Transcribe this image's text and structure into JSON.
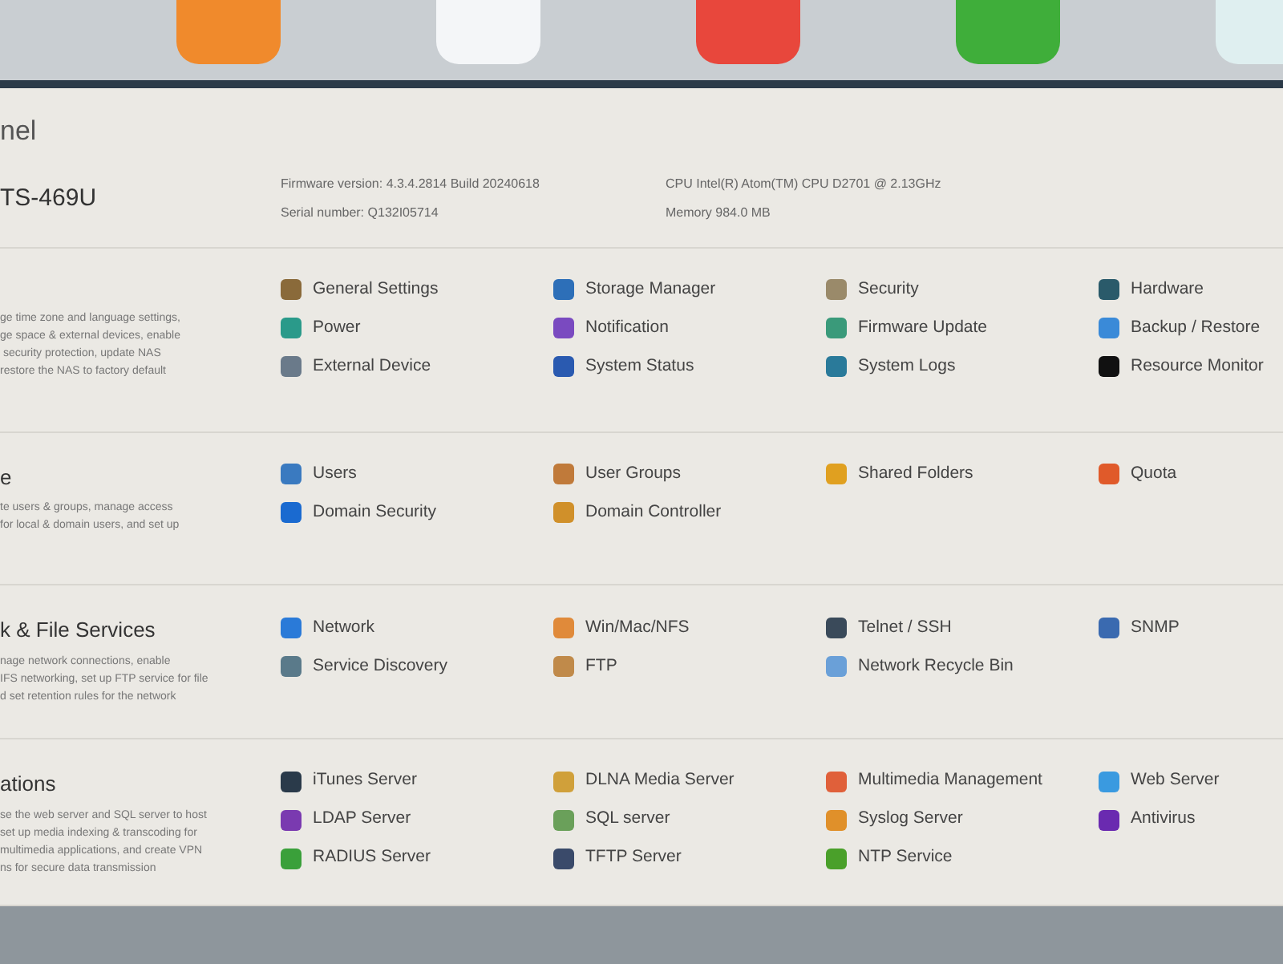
{
  "dock": {
    "apps": [
      {
        "color": "#f08a2c"
      },
      {
        "color": "#f4f6f8"
      },
      {
        "color": "#e8473c"
      },
      {
        "color": "#3fae3a"
      },
      {
        "color": "#dfeff0"
      }
    ]
  },
  "window": {
    "title": "nel"
  },
  "device": {
    "model": "TS-469U",
    "info": [
      {
        "label": "Firmware version:",
        "value": "4.3.4.2814 Build 20240618"
      },
      {
        "label": "CPU",
        "value": "Intel(R) Atom(TM) CPU D2701 @ 2.13GHz"
      },
      {
        "label": "Serial number:",
        "value": "Q132I05714"
      },
      {
        "label": "Memory",
        "value": "984.0 MB"
      }
    ]
  },
  "sections": [
    {
      "description": [
        "ge time zone and language settings,",
        "ge space & external devices, enable",
        " security protection, update NAS",
        "restore the NAS to factory default"
      ],
      "items": [
        {
          "label": "General Settings",
          "color": "#8a6a3a"
        },
        {
          "label": "Storage Manager",
          "color": "#2d6fb8"
        },
        {
          "label": "Security",
          "color": "#9a8a6a"
        },
        {
          "label": "Hardware",
          "color": "#2a5a6a"
        },
        {
          "label": "Power",
          "color": "#2a9a8a"
        },
        {
          "label": "Notification",
          "color": "#7a4ac0"
        },
        {
          "label": "Firmware Update",
          "color": "#3a9a7a"
        },
        {
          "label": "Backup / Restore",
          "color": "#3a8ad8"
        },
        {
          "label": "External Device",
          "color": "#6a7a8a"
        },
        {
          "label": "System Status",
          "color": "#2a5ab0"
        },
        {
          "label": "System Logs",
          "color": "#2a7a9a"
        },
        {
          "label": "Resource Monitor",
          "color": "#111111"
        }
      ]
    },
    {
      "title": "e",
      "description": [
        "te users & groups, manage access",
        "for local & domain users, and set up"
      ],
      "items": [
        {
          "label": "Users",
          "color": "#3a7ac0"
        },
        {
          "label": "User Groups",
          "color": "#c07a3a"
        },
        {
          "label": "Shared Folders",
          "color": "#e0a020"
        },
        {
          "label": "Quota",
          "color": "#e05a2a"
        },
        {
          "label": "Domain Security",
          "color": "#1a6ad0"
        },
        {
          "label": "Domain Controller",
          "color": "#d0902a"
        }
      ]
    },
    {
      "title": "k & File Services",
      "description": [
        "nage network connections, enable",
        "IFS networking, set up FTP service for file",
        "d set retention rules for the network"
      ],
      "items": [
        {
          "label": "Network",
          "color": "#2a7ad8"
        },
        {
          "label": "Win/Mac/NFS",
          "color": "#e08a3a"
        },
        {
          "label": "Telnet / SSH",
          "color": "#3a4a5a"
        },
        {
          "label": "SNMP",
          "color": "#3a6ab0"
        },
        {
          "label": "Service Discovery",
          "color": "#5a7a8a"
        },
        {
          "label": "FTP",
          "color": "#c08a4a"
        },
        {
          "label": "Network Recycle Bin",
          "color": "#6aa0d8"
        }
      ]
    },
    {
      "title": "ations",
      "description": [
        "se the web server and SQL server to host",
        "set up media indexing & transcoding for",
        "multimedia applications, and create VPN",
        "ns for secure data transmission"
      ],
      "items": [
        {
          "label": "iTunes Server",
          "color": "#2a3a4a"
        },
        {
          "label": "DLNA Media Server",
          "color": "#d0a03a"
        },
        {
          "label": "Multimedia Management",
          "color": "#e0603a"
        },
        {
          "label": "Web Server",
          "color": "#3a9ae0"
        },
        {
          "label": "LDAP Server",
          "color": "#7a3ab0"
        },
        {
          "label": "SQL server",
          "color": "#6aa05a"
        },
        {
          "label": "Syslog Server",
          "color": "#e0902a"
        },
        {
          "label": "Antivirus",
          "color": "#6a2ab0"
        },
        {
          "label": "RADIUS Server",
          "color": "#3aa03a"
        },
        {
          "label": "TFTP Server",
          "color": "#3a4a6a"
        },
        {
          "label": "NTP Service",
          "color": "#4aa02a"
        }
      ]
    }
  ]
}
